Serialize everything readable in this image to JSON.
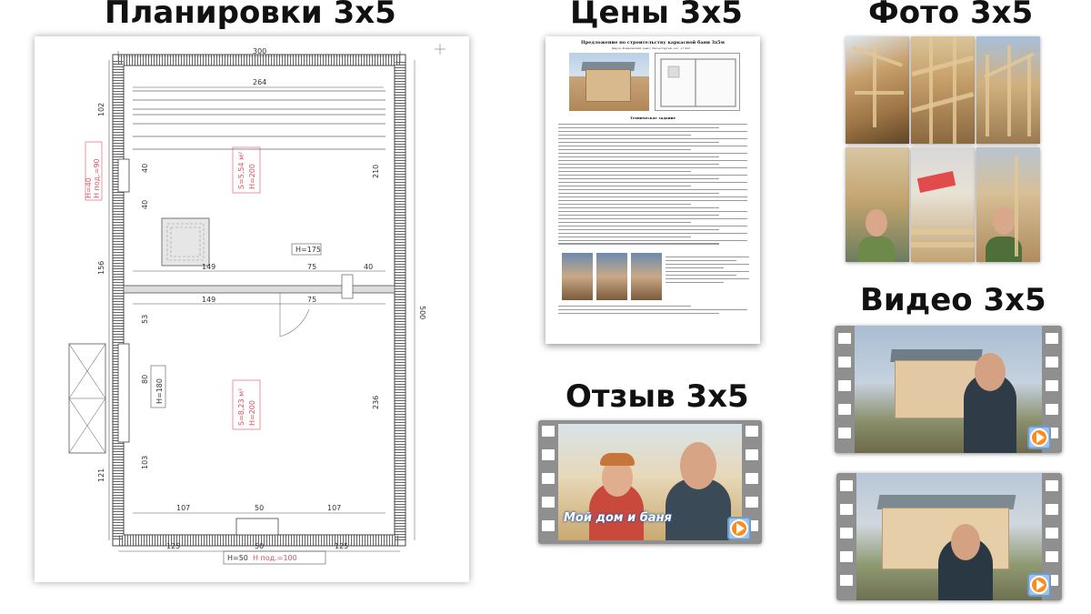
{
  "headings": {
    "plans": "Планировки 3х5",
    "prices": "Цены 3х5",
    "photos": "Фото 3х5",
    "video": "Видео 3х5",
    "review": "Отзыв 3х5"
  },
  "floor_plan": {
    "dimensions": {
      "width_outer": "300",
      "width_inner": "264",
      "length_total": "500",
      "left_top": "102",
      "left_40a": "40",
      "left_40b": "40",
      "left_156": "156",
      "left_53": "53",
      "left_80": "80",
      "left_103": "103",
      "left_121": "121",
      "right_210": "210",
      "right_236": "236",
      "mid_149a": "149",
      "mid_75a": "75",
      "mid_40": "40",
      "mid_149b": "149",
      "mid_75b": "75",
      "bottom_107a": "107",
      "bottom_50": "50",
      "bottom_107b": "107",
      "bottom_125a": "125",
      "bottom_50b": "50",
      "bottom_125b": "125"
    },
    "labels": {
      "window_left": "H=40",
      "window_left_sill": "H под.=90",
      "steam_area": "S=5,54 м²",
      "steam_height": "H=200",
      "stove_window": "H=175",
      "door_height": "H=180",
      "wash_area": "S=8,23 м²",
      "wash_height": "H=200",
      "bottom_window": "H=50",
      "bottom_window_sill": "H под.=100"
    }
  },
  "price_doc": {
    "title": "Предложение по строительству каркасной бани 3х5м",
    "subtitle": "Киров, Ковалёвский тракт, Ляхов Сергей, тел. +7 922 …",
    "section": "Техническое задание"
  },
  "review_overlay_text": "Мой дом и баня",
  "icons": [
    "play-button-icon",
    "play-button-icon",
    "play-button-icon"
  ]
}
